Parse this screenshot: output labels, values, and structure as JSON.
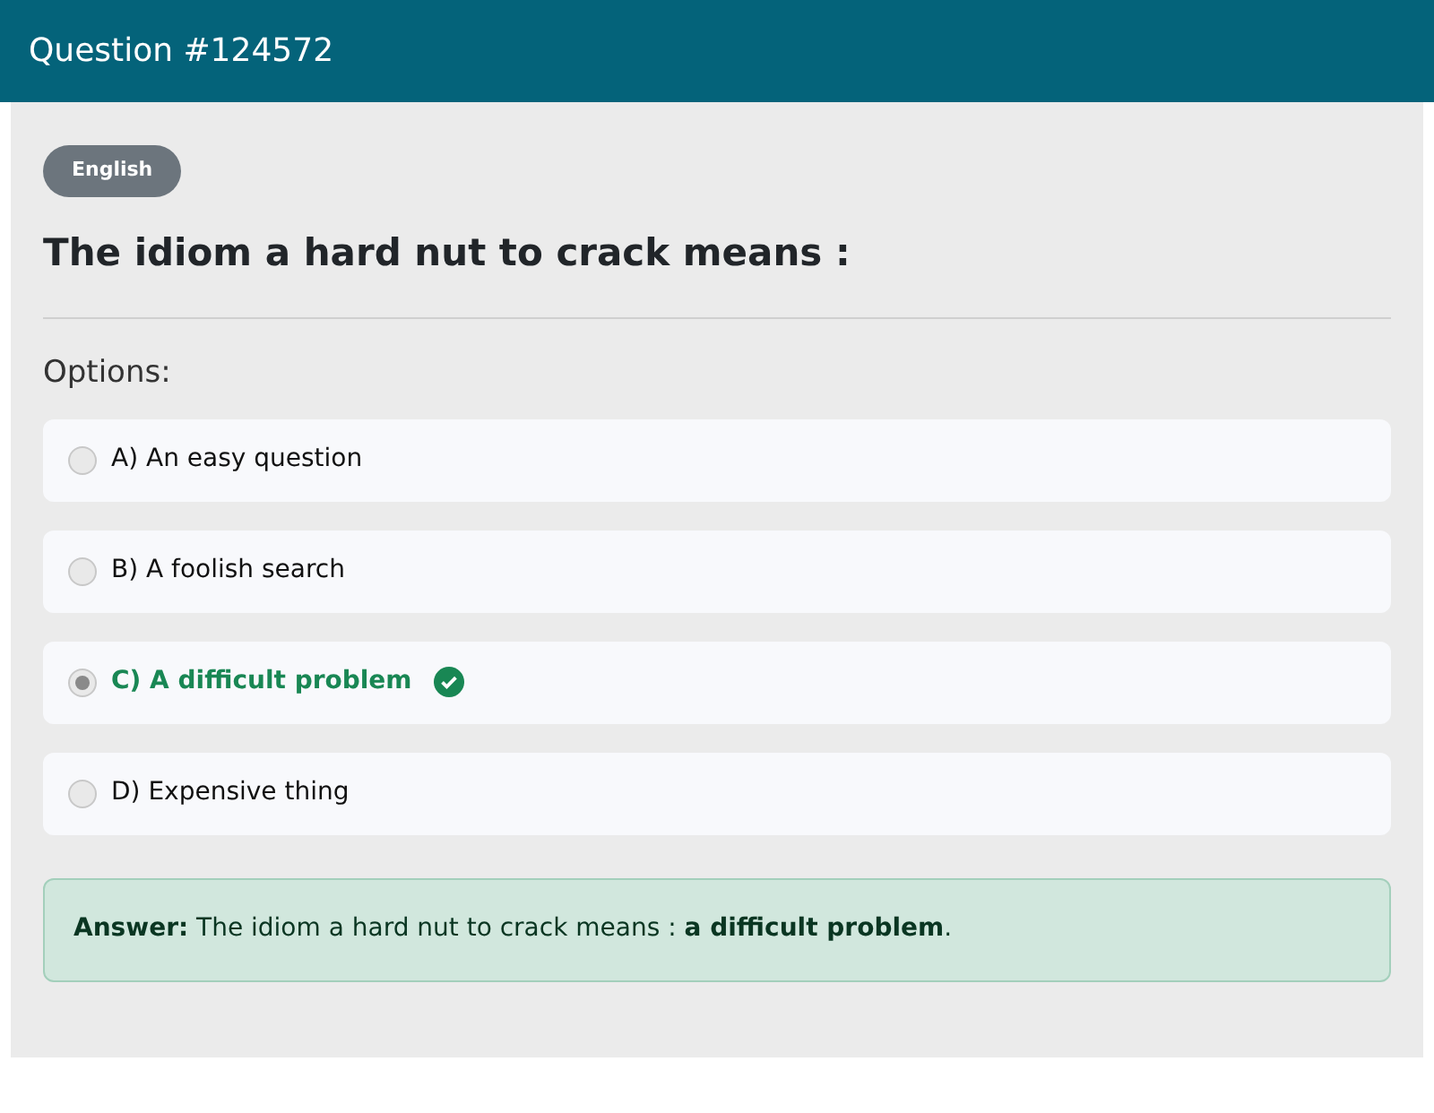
{
  "header": {
    "title": "Question #124572"
  },
  "badge": "English",
  "question": "The idiom a hard nut to crack means :",
  "options_label": "Options:",
  "options": [
    {
      "label": "A) An easy question",
      "selected": false,
      "correct": false
    },
    {
      "label": "B) A foolish search",
      "selected": false,
      "correct": false
    },
    {
      "label": "C) A difficult problem",
      "selected": true,
      "correct": true
    },
    {
      "label": "D) Expensive thing",
      "selected": false,
      "correct": false
    }
  ],
  "answer": "**Answer:** The idiom a hard nut to crack means : **a difficult problem**."
}
